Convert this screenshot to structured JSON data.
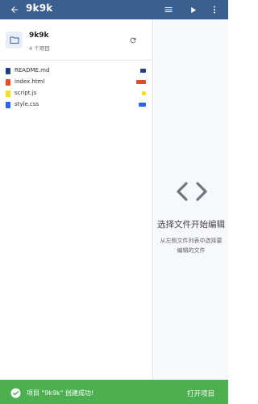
{
  "appbar": {
    "title": "9k9k",
    "background": "#3b5f8f",
    "icons": [
      "back-arrow-icon",
      "menu-icon",
      "play-icon",
      "more-vert-icon"
    ]
  },
  "project": {
    "name": "9k9k",
    "count_text": "4 个项目",
    "icons": [
      "folder-icon",
      "refresh-icon"
    ]
  },
  "files": [
    {
      "name": "README.md",
      "icon_color": "#1f3f8a",
      "badge_color": "#1f3f8a"
    },
    {
      "name": "index.html",
      "icon_color": "#e44d26",
      "badge_color": "#e44d26"
    },
    {
      "name": "script.js",
      "icon_color": "#f7df1e",
      "badge_color": "#f7df1e"
    },
    {
      "name": "style.css",
      "icon_color": "#2965f1",
      "badge_color": "#2965f1"
    }
  ],
  "editor_empty": {
    "icon": "code-brackets-icon",
    "title": "选择文件开始编辑",
    "subtitle_line1": "从左侧文件列表中选择要",
    "subtitle_line2": "编辑的文件"
  },
  "snackbar": {
    "message": "项目 \"9k9k\" 创建成功!",
    "action": "打开项目",
    "background": "#4caf50",
    "icon": "check-circle-icon"
  }
}
